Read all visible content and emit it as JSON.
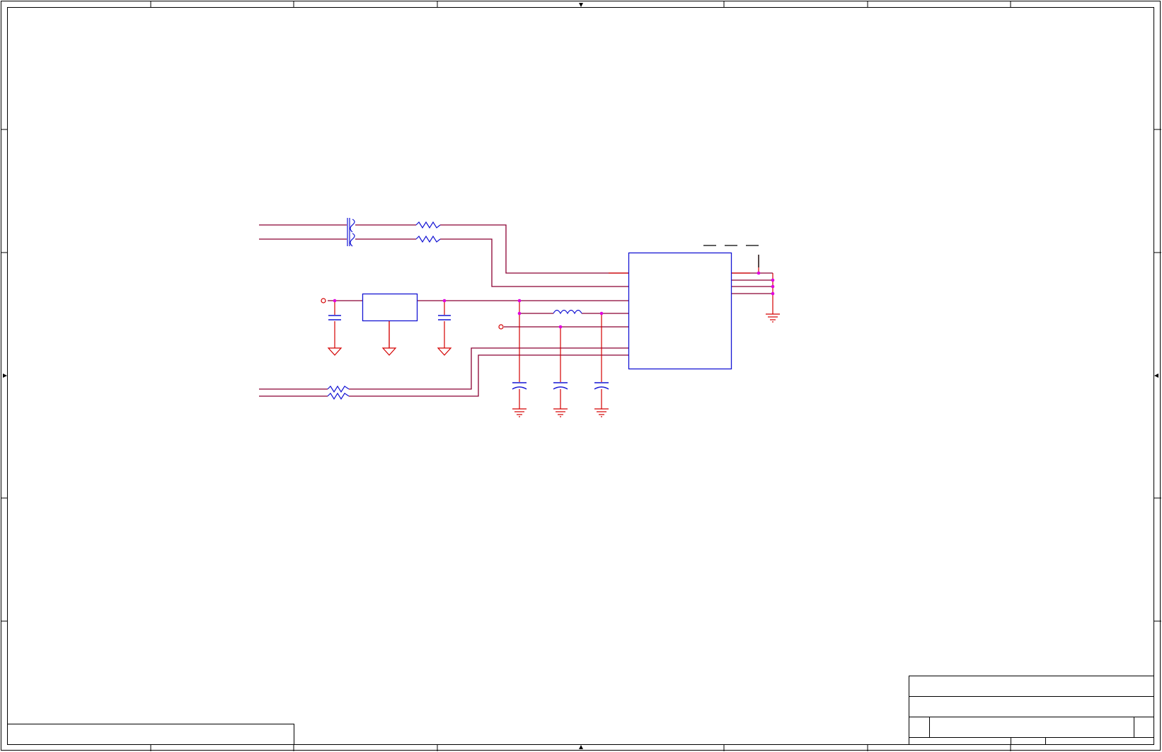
{
  "sheet": {
    "colors": {
      "frame": "#000000",
      "wire": "#d40000",
      "bus_wire": "#8b0033",
      "component": "#1515d4",
      "junction": "#e000e0",
      "background": "#ffffff"
    }
  },
  "title_block": {
    "title": "",
    "document_number": "",
    "revision": "",
    "size": "",
    "date": "",
    "sheet": ""
  },
  "components": [
    {
      "kind": "transformer",
      "icon": "transformer-icon"
    },
    {
      "kind": "resistor",
      "icon": "resistor-icon",
      "count": 4
    },
    {
      "kind": "regulator",
      "icon": "ic-box"
    },
    {
      "kind": "inductor",
      "icon": "inductor-icon"
    },
    {
      "kind": "capacitor",
      "icon": "capacitor-icon",
      "count": 5
    },
    {
      "kind": "ic",
      "icon": "ic-box"
    },
    {
      "kind": "ground",
      "icon": "ground-icon",
      "count": 7
    }
  ]
}
